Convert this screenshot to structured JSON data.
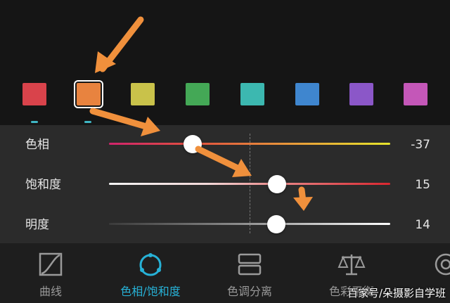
{
  "swatches": [
    {
      "name": "red",
      "color": "#d9434b"
    },
    {
      "name": "orange",
      "color": "#e8833f",
      "selected": true
    },
    {
      "name": "yellow",
      "color": "#c9c24a"
    },
    {
      "name": "green",
      "color": "#44a856"
    },
    {
      "name": "aqua",
      "color": "#3cb8b0"
    },
    {
      "name": "blue",
      "color": "#3f86cf"
    },
    {
      "name": "purple",
      "color": "#8b57c8"
    },
    {
      "name": "magenta",
      "color": "#c457b8"
    }
  ],
  "sliders": [
    {
      "label": "色相",
      "value": "-37",
      "level": -0.37
    },
    {
      "label": "饱和度",
      "value": "15",
      "level": 0.15
    },
    {
      "label": "明度",
      "value": "14",
      "level": 0.14
    }
  ],
  "toolbar": {
    "items": [
      {
        "label": "曲线",
        "icon": "curve-icon"
      },
      {
        "label": "色相/饱和度",
        "icon": "hsl-icon",
        "active": true
      },
      {
        "label": "色调分离",
        "icon": "split-tone-icon"
      },
      {
        "label": "色彩平衡",
        "icon": "balance-icon"
      },
      {
        "label": "",
        "icon": "partial-icon"
      }
    ]
  },
  "watermark": "百家号/朵摄影自学班",
  "colors": {
    "accent": "#27b1d6",
    "annotation_arrow": "#f0903c"
  }
}
